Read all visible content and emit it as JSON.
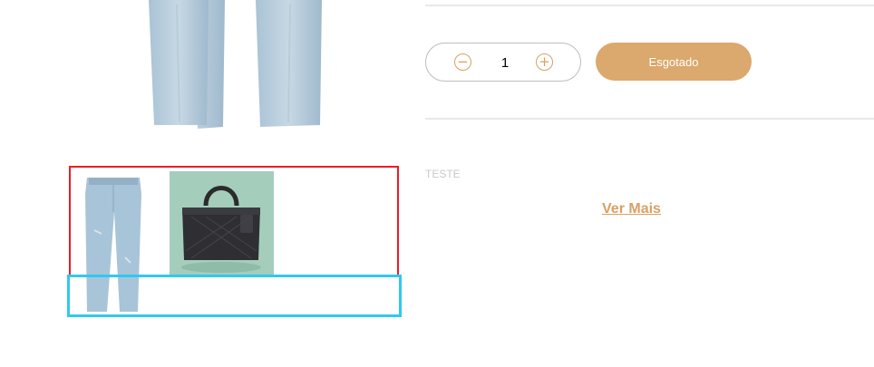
{
  "product": {
    "images": [
      {
        "name": "jeans",
        "alt": "Calça jeans"
      },
      {
        "name": "bag",
        "alt": "Bolsa"
      }
    ]
  },
  "quantity": {
    "value": "1",
    "minus_icon": "minus-circle-icon",
    "plus_icon": "plus-circle-icon"
  },
  "buy_button": {
    "label": "Esgotado"
  },
  "description": {
    "text": "TESTE"
  },
  "see_more": {
    "label": "Ver Mais"
  },
  "colors": {
    "accent": "#dba86d",
    "thumb_highlight": "#ee1c25",
    "nav_highlight": "#2fc9ef",
    "bag_background": "#a4cdbc"
  }
}
